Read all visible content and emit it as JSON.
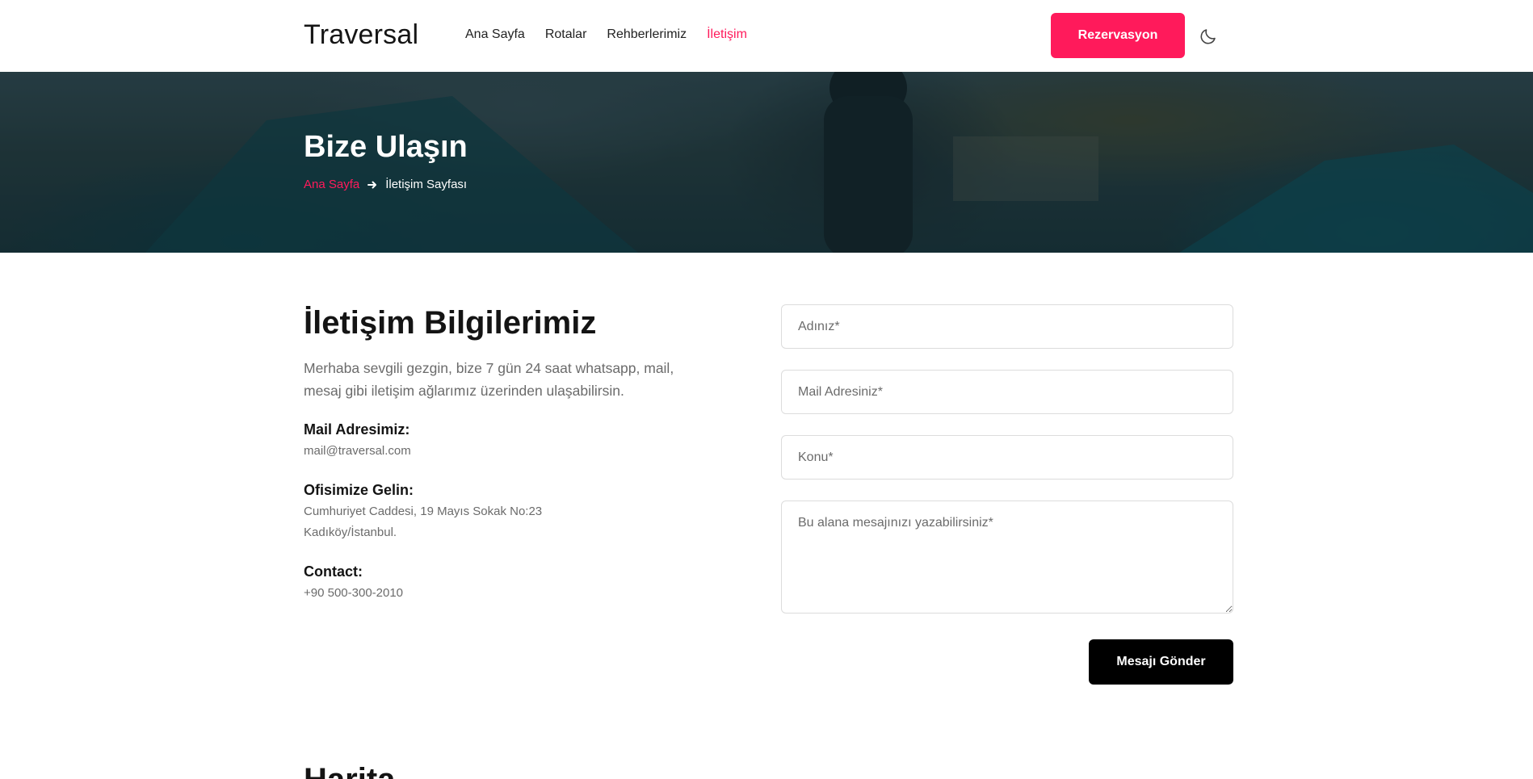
{
  "header": {
    "logo": "Traversal",
    "nav": [
      {
        "label": "Ana Sayfa",
        "active": false
      },
      {
        "label": "Rotalar",
        "active": false
      },
      {
        "label": "Rehberlerimiz",
        "active": false
      },
      {
        "label": "İletişim",
        "active": true
      }
    ],
    "reserve_label": "Rezervasyon",
    "theme_icon": "moon-icon"
  },
  "hero": {
    "title": "Bize Ulaşın",
    "breadcrumb": {
      "home": "Ana Sayfa",
      "separator_icon": "arrow-right-icon",
      "current": "İletişim Sayfası"
    }
  },
  "contact_info": {
    "title": "İletişim Bilgilerimiz",
    "intro": "Merhaba sevgili gezgin, bize 7 gün 24 saat whatsapp, mail, mesaj gibi iletişim ağlarımız üzerinden ulaşabilirsin.",
    "mail_label": "Mail Adresimiz:",
    "mail_value": "mail@traversal.com",
    "office_label": "Ofisimize Gelin:",
    "office_line1": "Cumhuriyet Caddesi, 19 Mayıs Sokak No:23",
    "office_line2": "Kadıköy/İstanbul.",
    "contact_label": "Contact:",
    "contact_value": "+90 500-300-2010"
  },
  "form": {
    "name_placeholder": "Adınız*",
    "email_placeholder": "Mail Adresiniz*",
    "subject_placeholder": "Konu*",
    "message_placeholder": "Bu alana mesajınızı yazabilirsiniz*",
    "name_value": "",
    "email_value": "",
    "subject_value": "",
    "message_value": "",
    "submit_label": "Mesajı Gönder"
  },
  "map_section": {
    "title": "Harita"
  },
  "colors": {
    "accent": "#ff1a5b",
    "dark_button": "#000000",
    "text_muted": "#6b6b6b"
  }
}
